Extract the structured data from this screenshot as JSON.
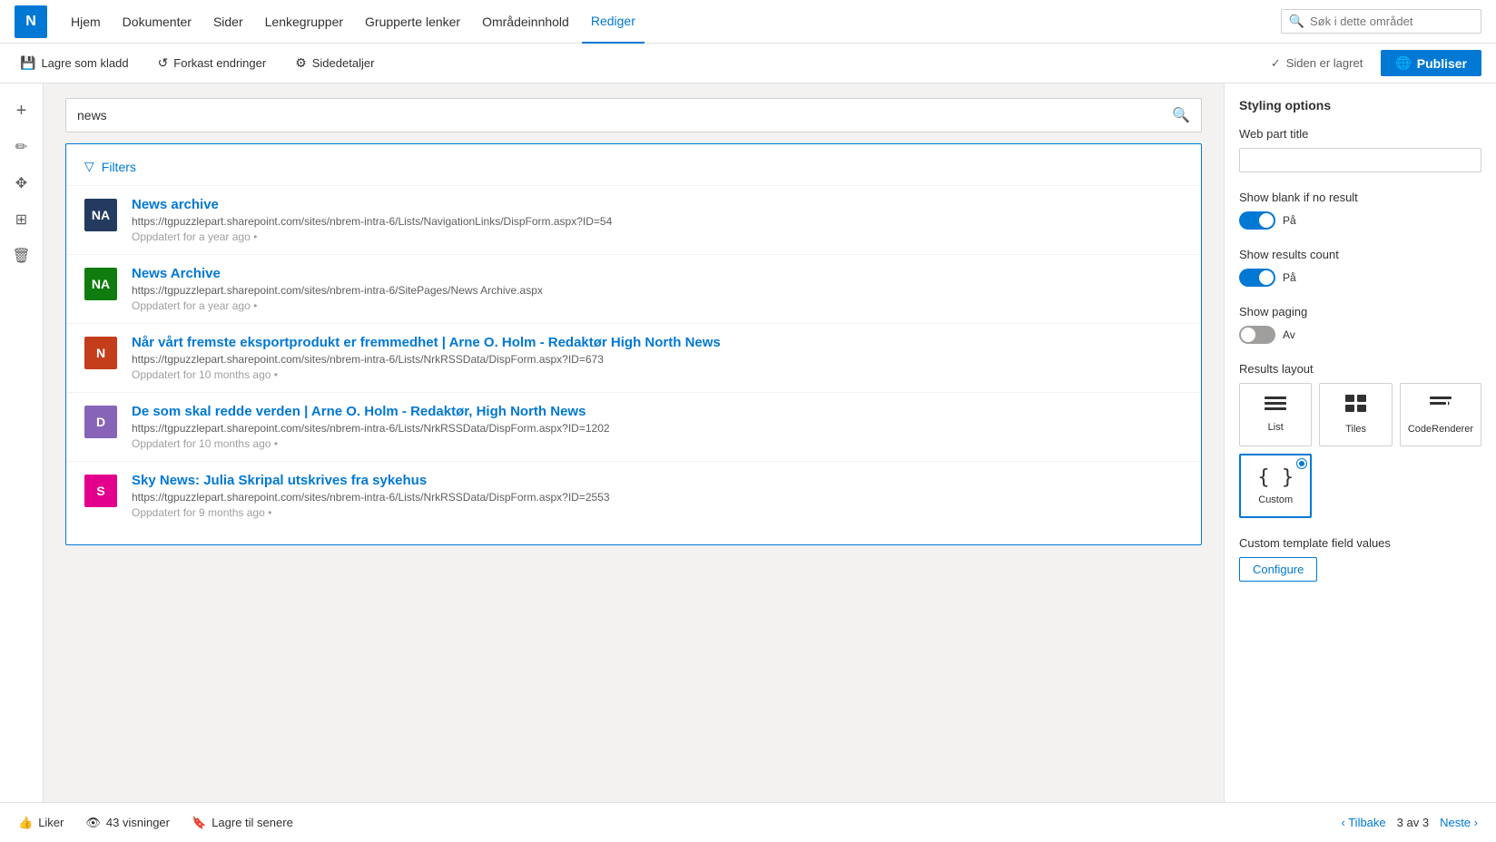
{
  "app": {
    "logo_initials": "N",
    "logo_bg": "#0078d4"
  },
  "nav": {
    "links": [
      {
        "label": "Hjem",
        "active": false
      },
      {
        "label": "Dokumenter",
        "active": false
      },
      {
        "label": "Sider",
        "active": false
      },
      {
        "label": "Lenkegrupper",
        "active": false
      },
      {
        "label": "Grupperte lenker",
        "active": false
      },
      {
        "label": "Områdeinnhold",
        "active": false
      },
      {
        "label": "Rediger",
        "active": true
      }
    ],
    "search_placeholder": "Søk i dette området"
  },
  "toolbar": {
    "save_draft": "Lagre som kladd",
    "discard": "Forkast endringer",
    "page_details": "Sidedetaljer",
    "status": "Siden er lagret",
    "publish": "Publiser"
  },
  "search": {
    "value": "news",
    "placeholder": "news"
  },
  "filters": {
    "label": "Filters"
  },
  "results": [
    {
      "id": "r1",
      "title": "News archive",
      "url": "https://tgpuzzlepart.sharepoint.com/sites/nbrem-intra-6/Lists/NavigationLinks/DispForm.aspx?ID=54",
      "meta": "Oppdatert for a year ago",
      "avatar_letter": "NA",
      "avatar_bg": "#243a5e"
    },
    {
      "id": "r2",
      "title": "News Archive",
      "url": "https://tgpuzzlepart.sharepoint.com/sites/nbrem-intra-6/SitePages/News Archive.aspx",
      "meta": "Oppdatert for a year ago",
      "avatar_letter": "NA",
      "avatar_bg": "#107c10"
    },
    {
      "id": "r3",
      "title": "Når vårt fremste eksportprodukt er fremmedhet | Arne O. Holm - Redaktør High North News",
      "url": "https://tgpuzzlepart.sharepoint.com/sites/nbrem-intra-6/Lists/NrkRSSData/DispForm.aspx?ID=673",
      "meta": "Oppdatert for 10 months ago",
      "avatar_letter": "N",
      "avatar_bg": "#c43e1c"
    },
    {
      "id": "r4",
      "title": "De som skal redde verden | Arne O. Holm - Redaktør, High North News",
      "url": "https://tgpuzzlepart.sharepoint.com/sites/nbrem-intra-6/Lists/NrkRSSData/DispForm.aspx?ID=1202",
      "meta": "Oppdatert for 10 months ago",
      "avatar_letter": "D",
      "avatar_bg": "#8764b8"
    },
    {
      "id": "r5",
      "title": "Sky News: Julia Skripal utskrives fra sykehus",
      "url": "https://tgpuzzlepart.sharepoint.com/sites/nbrem-intra-6/Lists/NrkRSSData/DispForm.aspx?ID=2553",
      "meta": "Oppdatert for 9 months ago",
      "avatar_letter": "S",
      "avatar_bg": "#e3008c"
    }
  ],
  "right_panel": {
    "title": "Styling options",
    "web_part_title_label": "Web part title",
    "web_part_title_value": "",
    "show_blank_label": "Show blank if no result",
    "show_blank_toggle": "on",
    "show_blank_toggle_text": "På",
    "show_results_label": "Show results count",
    "show_results_toggle": "on",
    "show_results_toggle_text": "På",
    "show_paging_label": "Show paging",
    "show_paging_toggle": "off",
    "show_paging_toggle_text": "Av",
    "results_layout_label": "Results layout",
    "layouts": [
      {
        "id": "list",
        "label": "List",
        "icon": "≡",
        "selected": false
      },
      {
        "id": "tiles",
        "label": "Tiles",
        "icon": "⊞",
        "selected": false
      },
      {
        "id": "coderenderer",
        "label": "CodeRenderer",
        "icon": "≡▼",
        "selected": false
      },
      {
        "id": "custom",
        "label": "Custom",
        "icon": "{}",
        "selected": true
      }
    ],
    "custom_template_label": "Custom template field values",
    "configure_btn": "Configure"
  },
  "bottom_bar": {
    "like_label": "Liker",
    "views_label": "43 visninger",
    "save_label": "Lagre til senere",
    "back_label": "Tilbake",
    "page_count": "3 av 3",
    "next_label": "Neste"
  }
}
